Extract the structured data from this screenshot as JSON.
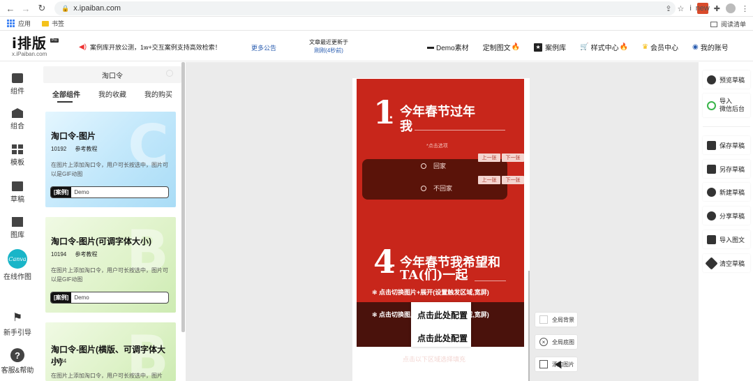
{
  "browser": {
    "url": "x.ipaiban.com",
    "bookmarks": [
      "应用",
      "书签"
    ],
    "reading_list": "阅读清单",
    "ext_badge": "new",
    "info_glyph": "i"
  },
  "header": {
    "logo": "i排版",
    "logo_sub": "x.iPaiban.com",
    "logo_badge": "Pro",
    "notice": "案例库开放公测，1w+交互案例支持高效检索！",
    "more_notice": "更多公告",
    "update_title": "文章最近更新于",
    "update_time": "刚刚(4秒前)",
    "nav": [
      {
        "label": "Demo素材",
        "icon": "folder-icon",
        "hot": false
      },
      {
        "label": "定制图文",
        "icon": "",
        "hot": true
      },
      {
        "label": "案例库",
        "icon": "star-box-icon",
        "hot": false
      },
      {
        "label": "样式中心",
        "icon": "cart-icon",
        "hot": true
      },
      {
        "label": "会员中心",
        "icon": "crown-icon",
        "hot": false
      },
      {
        "label": "我的账号",
        "icon": "user-icon",
        "hot": false
      }
    ]
  },
  "rail": {
    "items": [
      "组件",
      "组合",
      "模板",
      "草稿",
      "图库",
      "在线作图",
      "新手引导",
      "客服&帮助"
    ],
    "canva_logo": "Canva"
  },
  "panel": {
    "search_value": "淘口令",
    "tabs": [
      "全部组件",
      "我的收藏",
      "我的购买"
    ],
    "cards": [
      {
        "title": "淘口令-图片",
        "id": "10192",
        "ref": "参考教程",
        "desc": "在图片上添加淘口令，用户可长按选中，图片可以是GIF动图",
        "badge": "[案例]",
        "demo": "Demo",
        "letter": "C"
      },
      {
        "title": "淘口令-图片(可调字体大小)",
        "id": "10194",
        "ref": "参考教程",
        "desc": "在图片上添加淘口令，用户可长按选中，图片可以是GIF动图",
        "badge": "[案例]",
        "demo": "Demo",
        "letter": "B"
      },
      {
        "title": "淘口令-图片(横版、可调字体大小)",
        "id": "10834",
        "ref": "",
        "desc": "在图片上添加淘口令，用户可长按选中，图片",
        "badge": "",
        "demo": "",
        "letter": "B"
      }
    ]
  },
  "canvas": {
    "q1_num": "1",
    "q1_title_a": "今年春节过年",
    "q1_title_b": "我",
    "hint": "*点击选项",
    "options": [
      "回家",
      "不回家"
    ],
    "prev": "上一张",
    "next": "下一张",
    "q4_num": "4",
    "q4_title_a": "今年春节我希望和",
    "q4_title_b": "TA(们)一起",
    "click_line_1": "❃ 点击切换图片+展开(设置触发区域,宽屏)",
    "click_line_2": "❃ 点击切换图片+展开(设置触发区域,宽屏)",
    "config_1": "点击此处配置",
    "config_2": "点击此处配置",
    "faded": "点击以下区域选择填充",
    "float_buttons": [
      "全局背景",
      "全局底图",
      "添加图片"
    ]
  },
  "right_bar": {
    "buttons": [
      "预览草稿",
      "导入微信后台",
      "保存草稿",
      "另存草稿",
      "新建草稿",
      "分享草稿",
      "导入图文",
      "清空草稿"
    ],
    "wechat_line1": "导入",
    "wechat_line2": "微信后台"
  }
}
